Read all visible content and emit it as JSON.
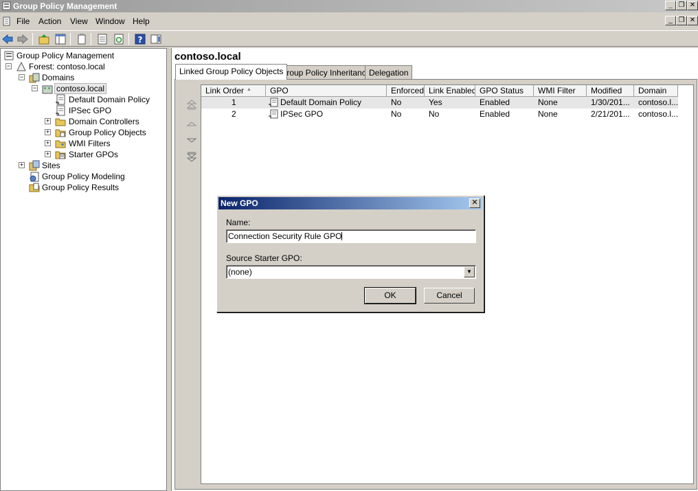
{
  "window": {
    "title": "Group Policy Management",
    "minimize_glyph": "_",
    "restore_glyph": "❐",
    "close_glyph": "✕"
  },
  "menu": {
    "items": [
      "File",
      "Action",
      "View",
      "Window",
      "Help"
    ]
  },
  "tree": {
    "root": "Group Policy Management",
    "forest": "Forest: contoso.local",
    "domains": "Domains",
    "domain": "contoso.local",
    "default_domain_policy": "Default Domain Policy",
    "ipsec_gpo": "IPSec GPO",
    "domain_controllers": "Domain Controllers",
    "group_policy_objects": "Group Policy Objects",
    "wmi_filters": "WMI Filters",
    "starter_gpos": "Starter GPOs",
    "sites": "Sites",
    "modeling": "Group Policy Modeling",
    "results": "Group Policy Results",
    "collapse_glyph": "−",
    "expand_glyph": "+"
  },
  "right": {
    "heading": "contoso.local",
    "tabs": [
      "Linked Group Policy Objects",
      "Group Policy Inheritance",
      "Delegation"
    ]
  },
  "table": {
    "columns": [
      "Link Order",
      "GPO",
      "Enforced",
      "Link Enabled",
      "GPO Status",
      "WMI Filter",
      "Modified",
      "Domain"
    ],
    "sort_glyph": "▲",
    "rows": [
      {
        "link_order": "1",
        "gpo": "Default Domain Policy",
        "enforced": "No",
        "link_enabled": "Yes",
        "gpo_status": "Enabled",
        "wmi_filter": "None",
        "modified": "1/30/201...",
        "domain": "contoso.l..."
      },
      {
        "link_order": "2",
        "gpo": "IPSec GPO",
        "enforced": "No",
        "link_enabled": "No",
        "gpo_status": "Enabled",
        "wmi_filter": "None",
        "modified": "2/21/201...",
        "domain": "contoso.l..."
      }
    ]
  },
  "dialog": {
    "title": "New GPO",
    "close_glyph": "✕",
    "name_label": "Name:",
    "name_value": "Connection Security Rule GPO",
    "source_label": "Source Starter GPO:",
    "source_value": "(none)",
    "dropdown_glyph": "▼",
    "ok_label": "OK",
    "cancel_label": "Cancel"
  },
  "colors": {
    "dialog_title_start": "#0a246a",
    "dialog_title_end": "#a6caf0",
    "face": "#d4d0c8"
  }
}
